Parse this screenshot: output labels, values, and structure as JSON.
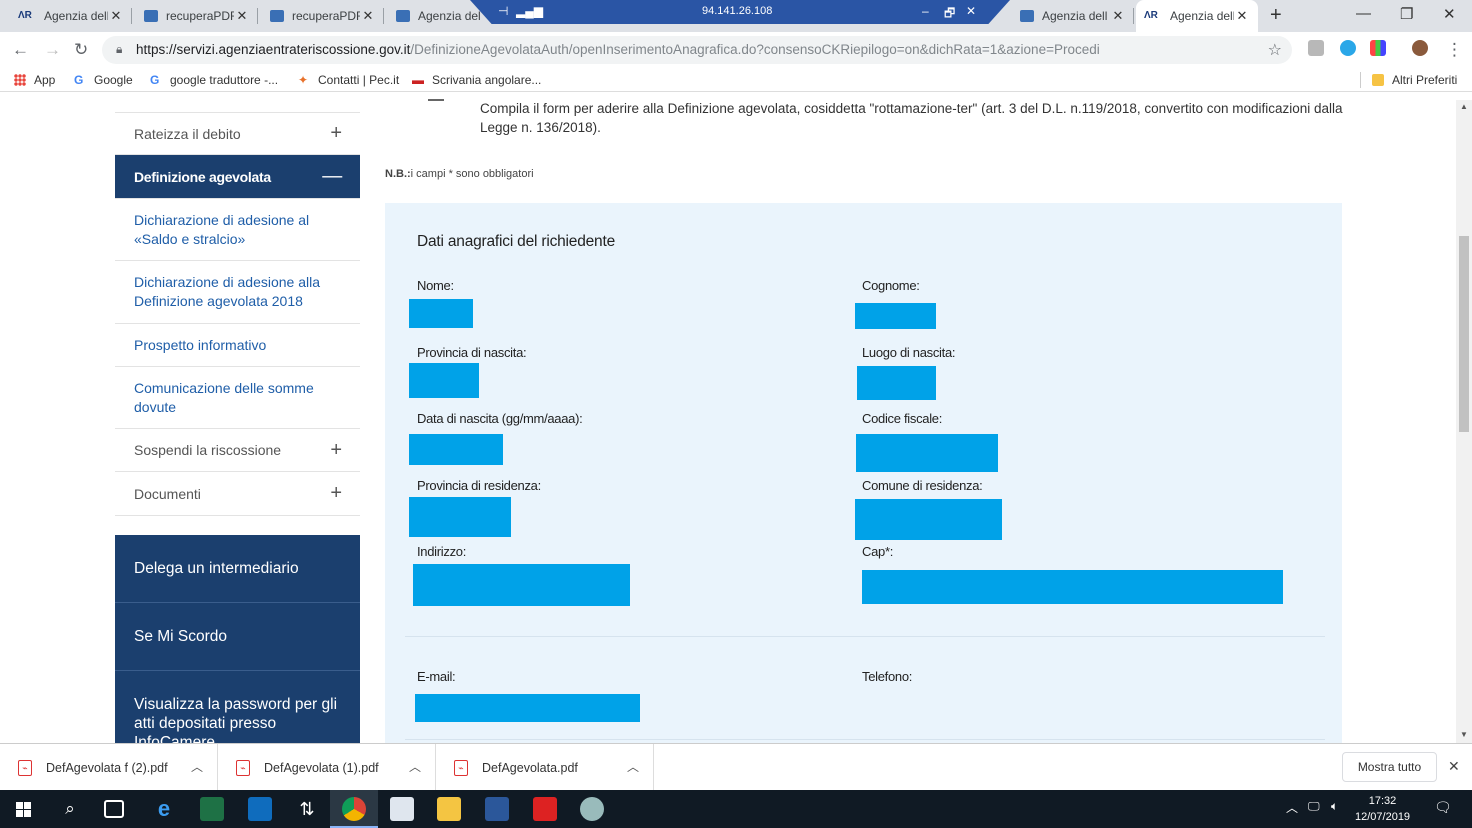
{
  "browser": {
    "tabs": [
      {
        "title": "Agenzia dell",
        "icon": "ar-logo-icon"
      },
      {
        "title": "recuperaPDF",
        "icon": "page-icon"
      },
      {
        "title": "recuperaPDF",
        "icon": "page-icon"
      },
      {
        "title": "Agenzia del",
        "icon": "page-icon"
      },
      {
        "title": "Agenzia dell",
        "icon": "page-icon"
      },
      {
        "title": "Agenzia dell",
        "icon": "ar-logo-icon"
      }
    ],
    "remote_ip": "94.141.26.108",
    "url_host": "https://servizi.agenziaentrateriscossione.gov.it",
    "url_path": "/DefinizioneAgevolataAuth/openInserimentoAnagrafica.do?consensoCKRiepilogo=on&dichRata=1&azione=Procedi"
  },
  "bookmarks": [
    {
      "label": "App"
    },
    {
      "label": "Google"
    },
    {
      "label": "google traduttore -..."
    },
    {
      "label": "Contatti | Pec.it"
    },
    {
      "label": "Scrivania angolare..."
    }
  ],
  "bookmarks_other": "Altri Preferiti",
  "sidebar": {
    "items": [
      {
        "label": "Rateizza il debito"
      },
      {
        "label": "Definizione agevolata"
      },
      {
        "label": "Dichiarazione di adesione al «Saldo e stralcio»"
      },
      {
        "label": "Dichiarazione di adesione alla Definizione agevolata 2018"
      },
      {
        "label": "Prospetto informativo"
      },
      {
        "label": "Comunicazione delle somme dovute"
      },
      {
        "label": "Sospendi la riscossione"
      },
      {
        "label": "Documenti"
      }
    ],
    "blocks": [
      {
        "label": "Delega un intermediario"
      },
      {
        "label": "Se Mi Scordo"
      },
      {
        "label": "Visualizza la password per gli atti depositati presso InfoCamere"
      }
    ]
  },
  "main": {
    "intro": "Compila il form per aderire alla Definizione agevolata, cosiddetta \"rottamazione-ter\" (art. 3 del D.L. n.119/2018, convertito con modificazioni dalla Legge n. 136/2018).",
    "nb_label": "N.B.:",
    "nb_text": "i campi * sono obbligatori",
    "form_title": "Dati anagrafici del richiedente",
    "fields": {
      "nome": "Nome:",
      "cognome": "Cognome:",
      "provincia_nascita": "Provincia di nascita:",
      "luogo_nascita": "Luogo di nascita:",
      "data_nascita": "Data di nascita (gg/mm/aaaa):",
      "codice_fiscale": "Codice fiscale:",
      "provincia_residenza": "Provincia di residenza:",
      "comune_residenza": "Comune di residenza:",
      "indirizzo": "Indirizzo:",
      "cap": "Cap*:",
      "email": "E-mail:",
      "telefono": "Telefono:"
    },
    "redaction_color": "#00a2e8"
  },
  "downloads": [
    {
      "name": "DefAgevolata f (2).pdf"
    },
    {
      "name": "DefAgevolata (1).pdf"
    },
    {
      "name": "DefAgevolata.pdf"
    }
  ],
  "downloads_show_all": "Mostra tutto",
  "taskbar": {
    "time": "17:32",
    "date": "12/07/2019"
  },
  "colors": {
    "sidebar_active": "#1b3f6e",
    "form_background": "#eaf4fc",
    "link": "#1f5ea8"
  }
}
